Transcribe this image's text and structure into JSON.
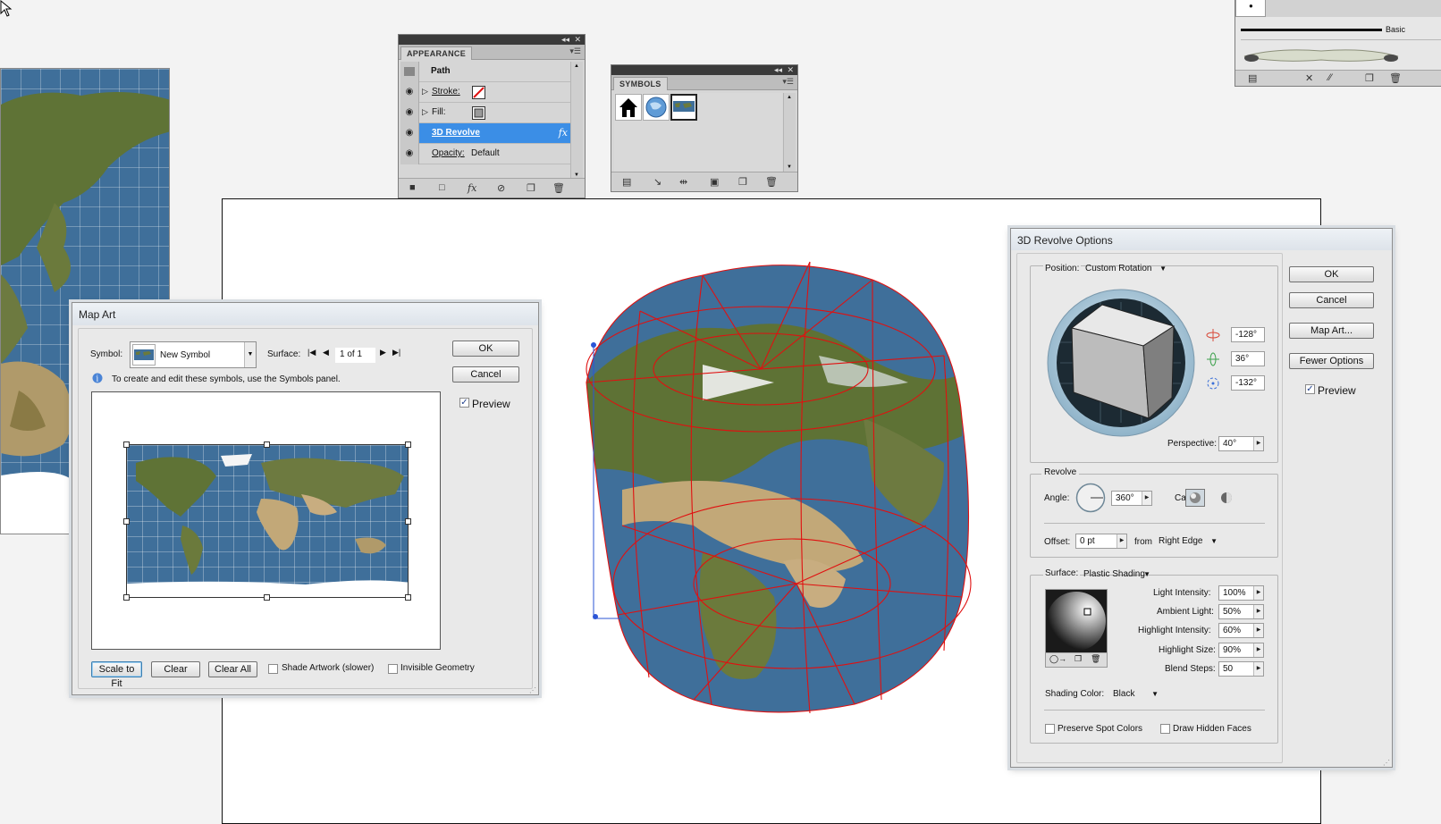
{
  "appearance_panel": {
    "tab": "APPEARANCE",
    "object": "Path",
    "rows": [
      {
        "label": "Stroke:"
      },
      {
        "label": "Fill:"
      },
      {
        "label": "3D Revolve",
        "badge": "fx"
      },
      {
        "label": "Opacity:",
        "value": "Default"
      }
    ]
  },
  "symbols_panel": {
    "tab": "SYMBOLS",
    "symbols": [
      "house-symbol",
      "globe-symbol",
      "map-symbol"
    ]
  },
  "brushes_panel": {
    "label": "Basic"
  },
  "map_art": {
    "title": "Map Art",
    "symbol_label": "Symbol:",
    "symbol_value": "New Symbol",
    "surface_label": "Surface:",
    "surface_value": "1 of 1",
    "info_text": "To create and edit these symbols, use the Symbols panel.",
    "ok": "OK",
    "cancel": "Cancel",
    "preview": "Preview",
    "preview_checked": true,
    "scale_to_fit": "Scale to Fit",
    "clear": "Clear",
    "clear_all": "Clear All",
    "shade_artwork": "Shade Artwork (slower)",
    "invisible_geometry": "Invisible Geometry"
  },
  "revolve_options": {
    "title": "3D Revolve Options",
    "position_label": "Position:",
    "position_value": "Custom Rotation",
    "rot_x": "-128°",
    "rot_y": "36°",
    "rot_z": "-132°",
    "perspective_label": "Perspective:",
    "perspective_value": "40°",
    "revolve_group": "Revolve",
    "angle_label": "Angle:",
    "angle_value": "360°",
    "cap_label": "Cap:",
    "offset_label": "Offset:",
    "offset_value": "0 pt",
    "from_label": "from",
    "from_value": "Right Edge",
    "surface_label": "Surface:",
    "surface_value": "Plastic Shading",
    "light_intensity_label": "Light Intensity:",
    "light_intensity": "100%",
    "ambient_light_label": "Ambient Light:",
    "ambient_light": "50%",
    "highlight_intensity_label": "Highlight Intensity:",
    "highlight_intensity": "60%",
    "highlight_size_label": "Highlight Size:",
    "highlight_size": "90%",
    "blend_steps_label": "Blend Steps:",
    "blend_steps": "50",
    "shading_color_label": "Shading Color:",
    "shading_color": "Black",
    "preserve_spot": "Preserve Spot Colors",
    "draw_hidden": "Draw Hidden Faces",
    "ok": "OK",
    "cancel": "Cancel",
    "map_art": "Map Art...",
    "fewer_options": "Fewer Options",
    "preview": "Preview",
    "preview_checked": true
  },
  "colors": {
    "ocean": "#3f6f9a",
    "land": "#6b7a3c",
    "desert": "#c2a878",
    "wireframe": "#e01010",
    "selection": "#3b8ee6"
  }
}
